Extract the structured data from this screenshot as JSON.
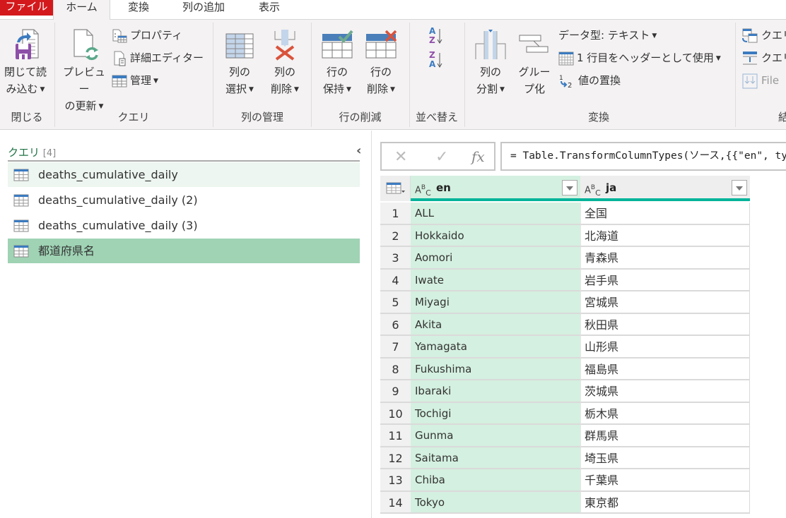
{
  "tabs": [
    {
      "label": "ファイル"
    },
    {
      "label": "ホーム"
    },
    {
      "label": "変換"
    },
    {
      "label": "列の追加"
    },
    {
      "label": "表示"
    }
  ],
  "ribbon": {
    "close_group": {
      "label": "閉じる",
      "close_load": {
        "line1": "閉じて読",
        "line2": "み込む"
      }
    },
    "query_group": {
      "label": "クエリ",
      "refresh_preview": {
        "line1": "プレビュー",
        "line2": "の更新"
      },
      "properties": "プロパティ",
      "advanced_editor": "詳細エディター",
      "manage": "管理"
    },
    "columns_group": {
      "label": "列の管理",
      "choose_columns": {
        "line1": "列の",
        "line2": "選択"
      },
      "remove_columns": {
        "line1": "列の",
        "line2": "削除"
      }
    },
    "rows_group": {
      "label": "行の削減",
      "keep_rows": {
        "line1": "行の",
        "line2": "保持"
      },
      "remove_rows": {
        "line1": "行の",
        "line2": "削除"
      }
    },
    "sort_group": {
      "label": "並べ替え"
    },
    "transform_group": {
      "label": "変換",
      "split_column": {
        "line1": "列の",
        "line2": "分割"
      },
      "group_by": {
        "line1": "グルー",
        "line2": "プ化"
      },
      "data_type": "データ型: テキスト",
      "use_first_row": "1 行目をヘッダーとして使用",
      "replace_values": "値の置換"
    },
    "combine_group": {
      "label": "結",
      "merge_queries": "クエリ",
      "append_queries": "クエリ",
      "combine_files": "File"
    }
  },
  "queries_pane": {
    "title": "クエリ",
    "count": "[4]",
    "items": [
      {
        "label": "deaths_cumulative_daily",
        "state": "hover"
      },
      {
        "label": "deaths_cumulative_daily (2)",
        "state": "normal"
      },
      {
        "label": "deaths_cumulative_daily (3)",
        "state": "normal"
      },
      {
        "label": "都道府県名",
        "state": "selected"
      }
    ]
  },
  "formula_bar": {
    "cancel": "✕",
    "commit": "✓",
    "fx": "fx",
    "formula": "= Table.TransformColumnTypes(ソース,{{\"en\", type text}, {\"ja\", type text}})"
  },
  "grid": {
    "columns": [
      {
        "type": "ABC",
        "name": "en"
      },
      {
        "type": "ABC",
        "name": "ja"
      }
    ],
    "rows": [
      {
        "n": "1",
        "en": "ALL",
        "ja": "全国"
      },
      {
        "n": "2",
        "en": "Hokkaido",
        "ja": "北海道"
      },
      {
        "n": "3",
        "en": "Aomori",
        "ja": "青森県"
      },
      {
        "n": "4",
        "en": "Iwate",
        "ja": "岩手県"
      },
      {
        "n": "5",
        "en": "Miyagi",
        "ja": "宮城県"
      },
      {
        "n": "6",
        "en": "Akita",
        "ja": "秋田県"
      },
      {
        "n": "7",
        "en": "Yamagata",
        "ja": "山形県"
      },
      {
        "n": "8",
        "en": "Fukushima",
        "ja": "福島県"
      },
      {
        "n": "9",
        "en": "Ibaraki",
        "ja": "茨城県"
      },
      {
        "n": "10",
        "en": "Tochigi",
        "ja": "栃木県"
      },
      {
        "n": "11",
        "en": "Gunma",
        "ja": "群馬県"
      },
      {
        "n": "12",
        "en": "Saitama",
        "ja": "埼玉県"
      },
      {
        "n": "13",
        "en": "Chiba",
        "ja": "千葉県"
      },
      {
        "n": "14",
        "en": "Tokyo",
        "ja": "東京都"
      }
    ]
  }
}
